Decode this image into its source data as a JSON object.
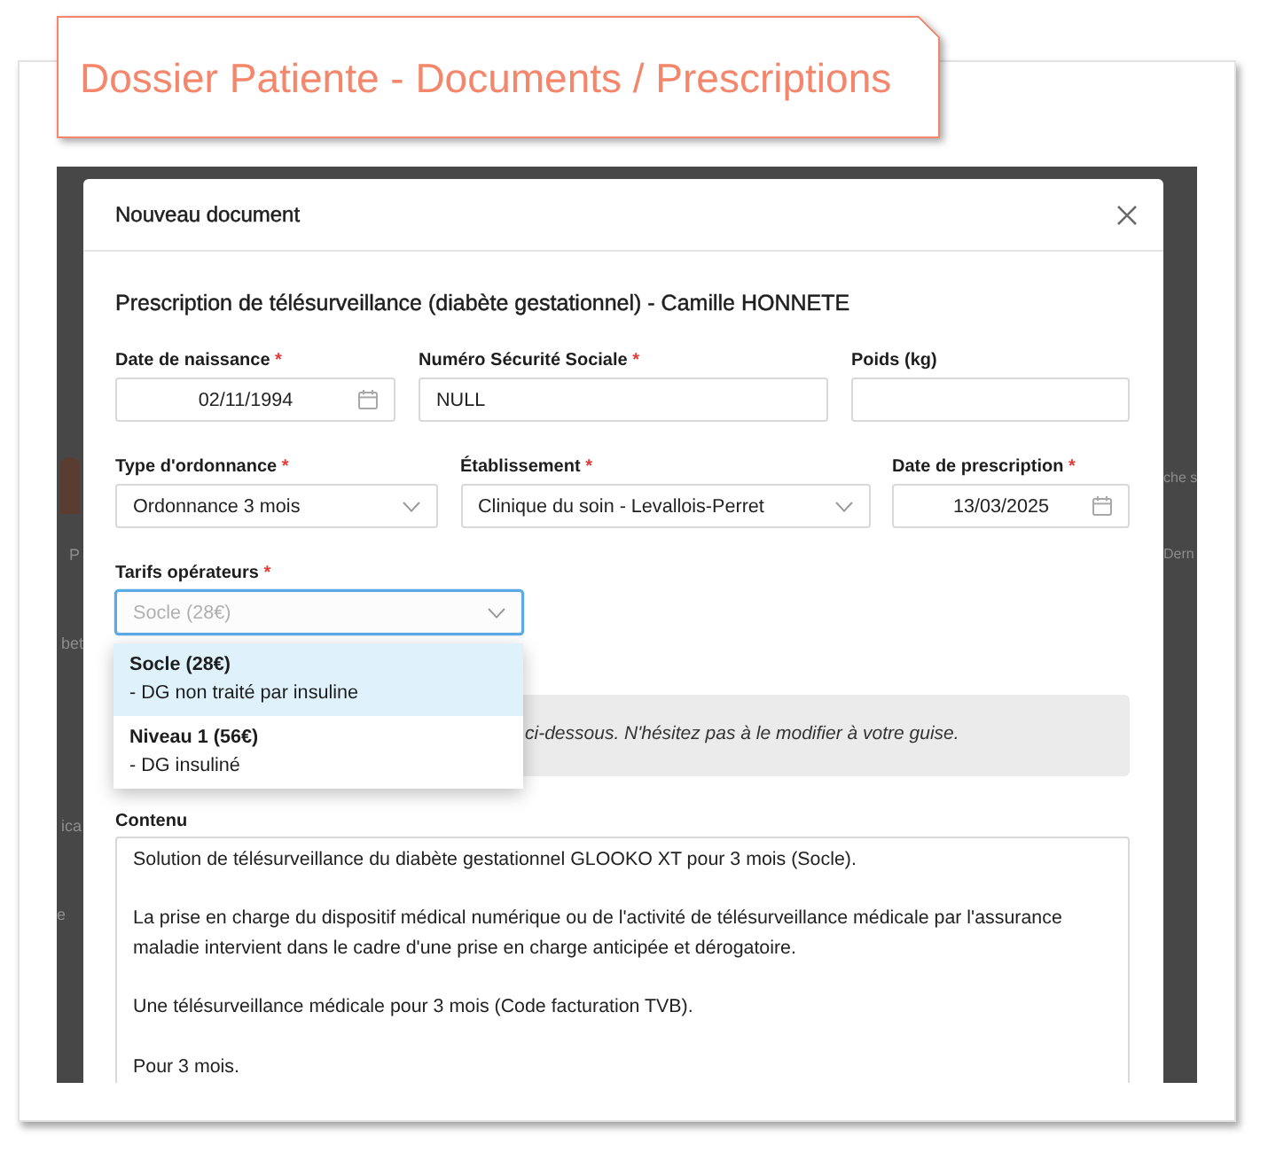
{
  "page_title": "Dossier Patiente - Documents / Prescriptions",
  "backdrop": {
    "left_fragments": [
      "P",
      "bet",
      "ica",
      "e"
    ],
    "right_fragments": [
      "che s",
      "Dern"
    ]
  },
  "modal": {
    "title": "Nouveau document",
    "subtitle": "Prescription de télésurveillance (diabète gestationnel) - Camille HONNETE",
    "rows": [
      [
        {
          "kind": "date",
          "label": "Date de naissance",
          "required_mark": "*",
          "value": "02/11/1994"
        },
        {
          "kind": "text",
          "label": "Numéro Sécurité Sociale",
          "required_mark": "*",
          "value": "NULL"
        },
        {
          "kind": "text",
          "label": "Poids (kg)"
        }
      ],
      [
        {
          "kind": "select",
          "label": "Type d'ordonnance",
          "required_mark": "*",
          "value": "Ordonnance 3 mois"
        },
        {
          "kind": "select",
          "label": "Établissement",
          "required_mark": "*",
          "value": "Clinique du soin - Levallois-Perret"
        },
        {
          "kind": "date",
          "label": "Date de prescription",
          "required_mark": "*",
          "value": "13/03/2025"
        }
      ],
      [
        {
          "kind": "select",
          "label": "Tarifs opérateurs",
          "required_mark": "*",
          "placeholder": "Socle (28€)",
          "focused": true,
          "expanded": true,
          "options": [
            {
              "title": "Socle (28€)",
              "description": "- DG non traité par insuline",
              "selected": true
            },
            {
              "title": "Niveau 1 (56€)",
              "description": "- DG insuliné",
              "selected": false
            }
          ]
        }
      ]
    ],
    "note": "ci-dessous. N'hésitez pas à le modifier à votre guise.",
    "content": {
      "label": "Contenu",
      "paragraphs": [
        "Solution de télésurveillance du diabète gestationnel GLOOKO XT pour 3 mois (Socle).",
        "La prise en charge du dispositif médical numérique ou de l'activité de télésurveillance médicale par l'assurance maladie intervient dans le cadre d'une prise en charge anticipée et dérogatoire.",
        "Une télésurveillance médicale pour 3 mois (Code facturation TVB).",
        "Pour 3 mois."
      ]
    }
  }
}
